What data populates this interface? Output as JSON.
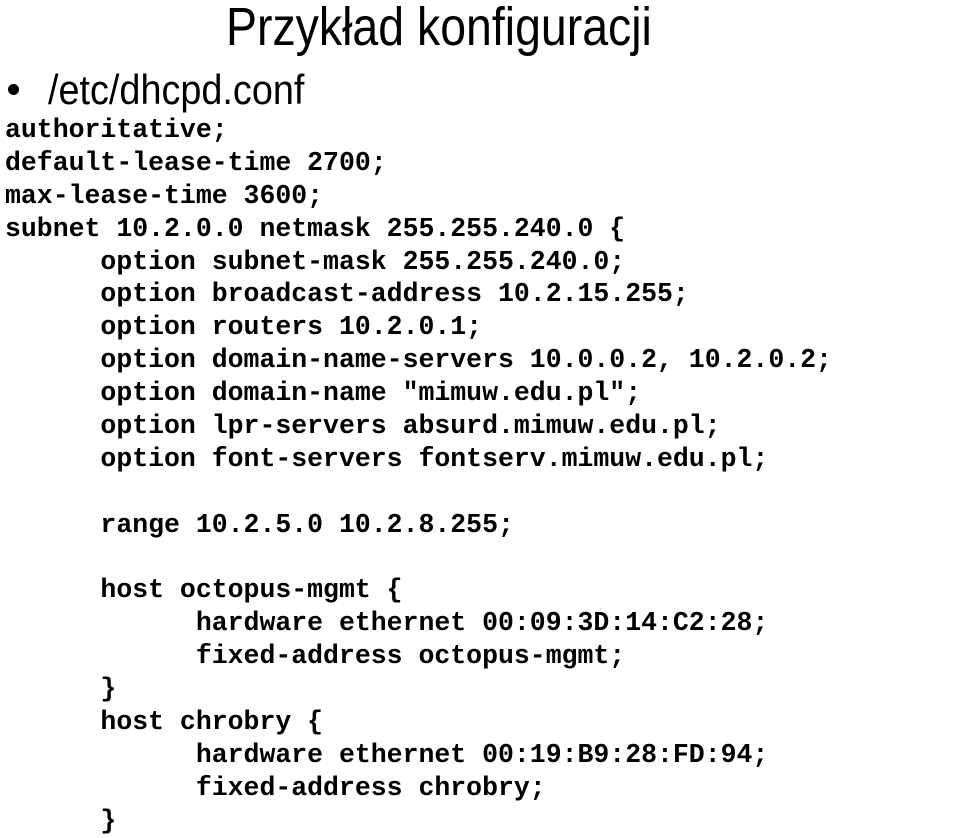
{
  "slide": {
    "title": "Przykład konfiguracji",
    "bullet": "/etc/dhcpd.conf",
    "code_lines": [
      "authoritative;",
      "default-lease-time 2700;",
      "max-lease-time 3600;",
      "subnet 10.2.0.0 netmask 255.255.240.0 {",
      "      option subnet-mask 255.255.240.0;",
      "      option broadcast-address 10.2.15.255;",
      "      option routers 10.2.0.1;",
      "      option domain-name-servers 10.0.0.2, 10.2.0.2;",
      "      option domain-name \"mimuw.edu.pl\";",
      "      option lpr-servers absurd.mimuw.edu.pl;",
      "      option font-servers fontserv.mimuw.edu.pl;",
      "",
      "      range 10.2.5.0 10.2.8.255;",
      "",
      "      host octopus-mgmt {",
      "            hardware ethernet 00:09:3D:14:C2:28;",
      "            fixed-address octopus-mgmt;",
      "      }",
      "      host chrobry {",
      "            hardware ethernet 00:19:B9:28:FD:94;",
      "            fixed-address chrobry;",
      "      }"
    ]
  }
}
